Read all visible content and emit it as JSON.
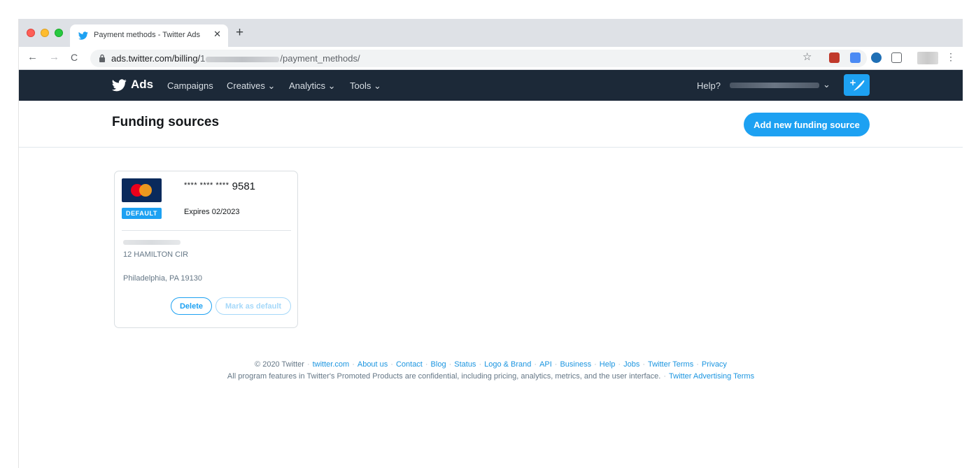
{
  "browser": {
    "tab_title": "Payment methods - Twitter Ads",
    "tab_close": "✕",
    "new_tab": "+",
    "url_host": "ads.twitter.com/billing/",
    "url_prefix_char": "1",
    "url_path": "/payment_methods/"
  },
  "nav": {
    "brand": "Ads",
    "items": [
      {
        "label": "Campaigns"
      },
      {
        "label": "Creatives ⌄"
      },
      {
        "label": "Analytics ⌄"
      },
      {
        "label": "Tools ⌄"
      }
    ],
    "help": "Help?",
    "account_chevron": "⌄"
  },
  "page": {
    "title": "Funding sources",
    "add_button": "Add new funding source"
  },
  "card": {
    "masked_prefix": "**** **** ****",
    "last4": "9581",
    "badge": "DEFAULT",
    "expires": "Expires 02/2023",
    "address_line1": "12 HAMILTON CIR",
    "address_line2": "Philadelphia, PA 19130",
    "delete_label": "Delete",
    "mark_default_label": "Mark as default"
  },
  "footer": {
    "copyright": "© 2020 Twitter",
    "links": [
      "twitter.com",
      "About us",
      "Contact",
      "Blog",
      "Status",
      "Logo & Brand",
      "API",
      "Business",
      "Help",
      "Jobs",
      "Twitter Terms",
      "Privacy"
    ],
    "disclaimer": "All program features in Twitter's Promoted Products are confidential, including pricing, analytics, metrics, and the user interface.",
    "ad_terms": "Twitter Advertising Terms"
  },
  "colors": {
    "twitter_blue": "#1da1f2",
    "navbar": "#1c2938"
  }
}
